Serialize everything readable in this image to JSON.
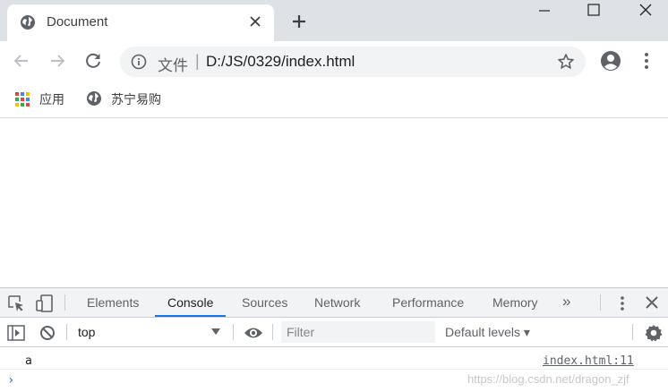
{
  "tab": {
    "title": "Document"
  },
  "address": {
    "scheme": "文件",
    "separator": "|",
    "url": "D:/JS/0329/index.html"
  },
  "bookmarks": {
    "items": [
      {
        "label": "应用"
      },
      {
        "label": "苏宁易购"
      }
    ]
  },
  "devtools": {
    "tabs": [
      {
        "label": "Elements"
      },
      {
        "label": "Console"
      },
      {
        "label": "Sources"
      },
      {
        "label": "Network"
      },
      {
        "label": "Performance"
      },
      {
        "label": "Memory"
      }
    ],
    "active_tab": "Console",
    "more_tabs": "»",
    "context": "top",
    "filter_placeholder": "Filter",
    "levels": "Default levels ▾",
    "log": {
      "text": "a",
      "source": "index.html:11"
    },
    "prompt": "›"
  },
  "watermark": "https://blog.csdn.net/dragon_zjf",
  "colors": {
    "accent": "#1a73e8",
    "tabstrip": "#dee1e6",
    "toolbar_bg": "#f1f3f4"
  }
}
